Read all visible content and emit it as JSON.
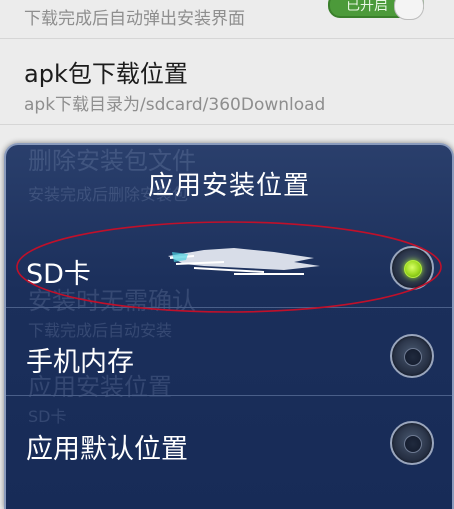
{
  "background": {
    "top_subtitle": "下载完成后自动弹出安装界面",
    "top_toggle_text": "已开启",
    "apk_title": "apk包下载位置",
    "apk_subtitle": "apk下载目录为/sdcard/360Download",
    "ghost_lines": [
      "删除安装包文件",
      "安装完成后删除安装包",
      "安装时无需确认",
      "下载完成后自动安装",
      "应用安装位置",
      "SD卡"
    ]
  },
  "dialog": {
    "title": "应用安装位置",
    "options": [
      {
        "label": "SD卡",
        "selected": true
      },
      {
        "label": "手机内存",
        "selected": false
      },
      {
        "label": "应用默认位置",
        "selected": false
      }
    ]
  },
  "colors": {
    "dialog_bg": "#1b2f5b",
    "selected_radio": "#9bd81f",
    "annotation": "#c0102a"
  }
}
